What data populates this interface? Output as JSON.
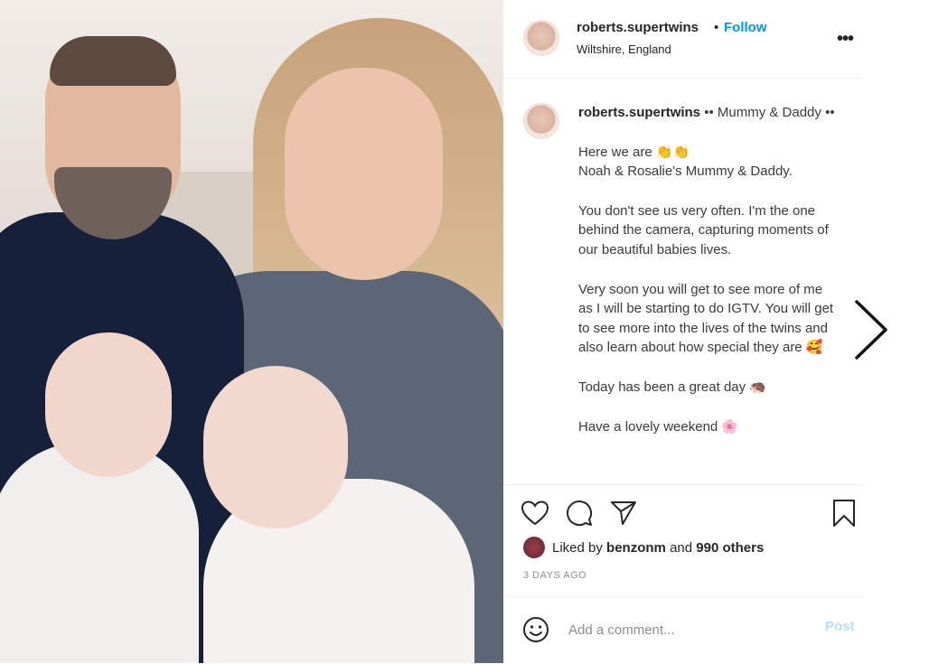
{
  "post": {
    "username": "roberts.supertwins",
    "separator": "•",
    "follow_label": "Follow",
    "location": "Wiltshire, England",
    "more_icon": "more-options-icon"
  },
  "caption": {
    "username": "roberts.supertwins",
    "line1": "•• Mummy & Daddy ••",
    "line2": "Here we are 👏👏",
    "line3": "Noah & Rosalie's Mummy & Daddy.",
    "para2": "You don't see us very often. I'm the one behind the camera, capturing moments of our beautiful babies lives.",
    "para3": "Very soon you will get to see more of me as I will be starting to do IGTV. You will get to see more into the lives of the twins and also learn about how special they are 🥰",
    "para4": "Today has been a great day 🦔",
    "para5": "Have a lovely weekend 🌸"
  },
  "actions": {
    "like_icon": "heart-icon",
    "comment_icon": "comment-icon",
    "share_icon": "share-icon",
    "save_icon": "bookmark-icon"
  },
  "likes": {
    "prefix": "Liked by",
    "user": "benzonm",
    "and_text": "and",
    "others": "990 others"
  },
  "timestamp": "3 DAYS AGO",
  "comment": {
    "placeholder": "Add a comment...",
    "post_label": "Post"
  },
  "colors": {
    "follow": "#0095f6",
    "post_disabled": "#b2dffc",
    "muted": "#8e8e8e",
    "text": "#262626"
  }
}
